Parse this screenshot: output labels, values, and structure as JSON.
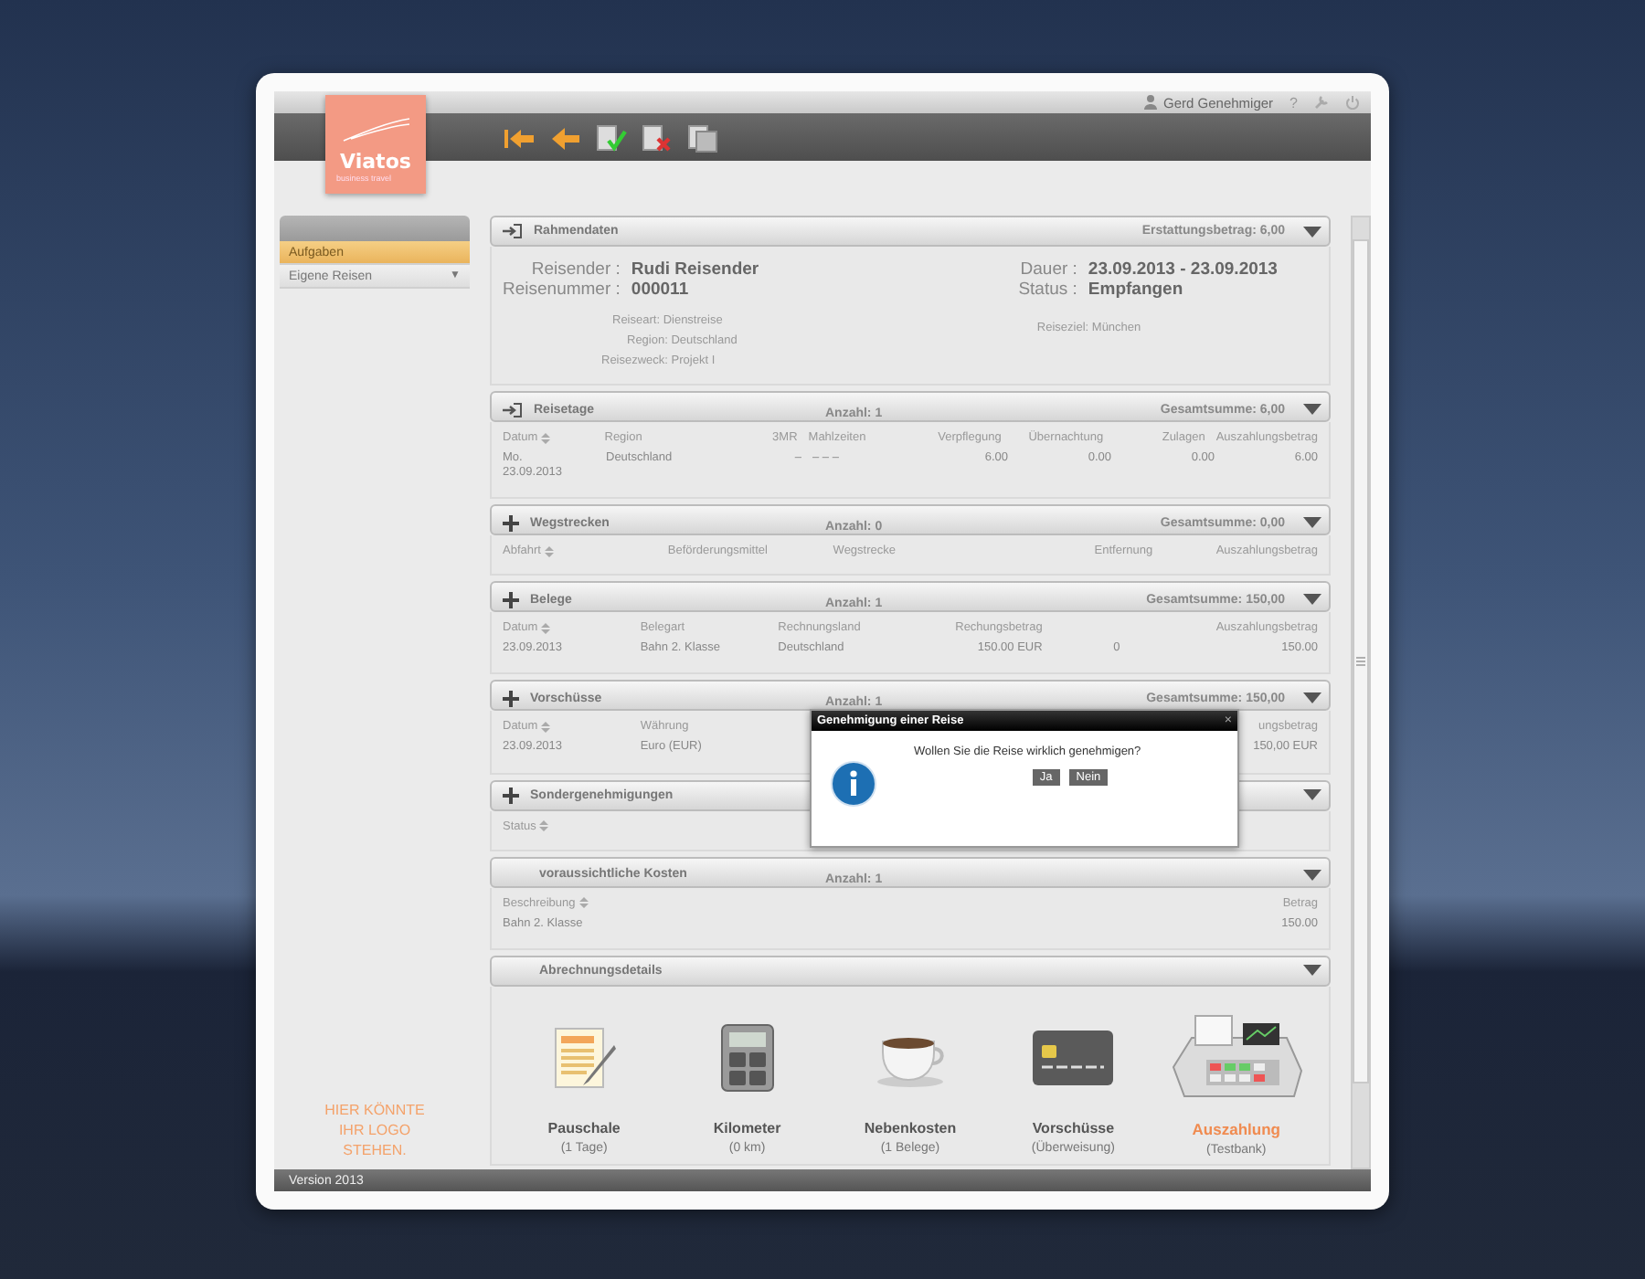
{
  "user": {
    "name": "Gerd Genehmiger",
    "help": "?"
  },
  "logo": {
    "name": "Viatos",
    "tagline": "business travel"
  },
  "sidebar": {
    "items": [
      {
        "label": "Aufgaben",
        "selected": true
      },
      {
        "label": "Eigene Reisen",
        "selected": false,
        "caret": "▼"
      }
    ]
  },
  "ad_lines": [
    "HIER KÖNNTE",
    "IHR LOGO",
    "STEHEN."
  ],
  "sections": [
    {
      "kind": "summary",
      "title": "Rahmendaten",
      "total": "Erstattungsbetrag: 6,00",
      "main_left": [
        {
          "label": "Reisender :",
          "value": "Rudi Reisender"
        },
        {
          "label": "Reisenummer :",
          "value": "000011"
        }
      ],
      "main_right": [
        {
          "label": "Dauer :",
          "value": "23.09.2013 - 23.09.2013"
        },
        {
          "label": "Status :",
          "value": "Empfangen"
        }
      ],
      "minor_left": [
        "Reiseart: Dienstreise",
        "Region: Deutschland",
        "Reisezweck: Projekt I"
      ],
      "minor_right": [
        "Reiseziel: München"
      ]
    },
    {
      "kind": "table",
      "title": "Reisetage",
      "count": "Anzahl: 1",
      "total": "Gesamtsumme: 6,00",
      "columns": [
        {
          "label": "Datum",
          "sortable": true
        },
        {
          "label": "Region",
          "sortable": false
        },
        {
          "label": "3MR",
          "sortable": false
        },
        {
          "label": "Mahlzeiten",
          "sortable": false
        },
        {
          "label": "Verpflegung",
          "sortable": false
        },
        {
          "label": "Übernachtung",
          "sortable": false
        },
        {
          "label": "Zulagen",
          "sortable": false
        },
        {
          "label": "Auszahlungsbetrag",
          "sortable": false
        }
      ],
      "rows": [
        [
          "Mo. 23.09.2013",
          "Deutschland",
          "–",
          "– – –",
          "6.00",
          "0.00",
          "0.00",
          "6.00"
        ]
      ]
    },
    {
      "kind": "table",
      "title": "Wegstrecken",
      "count": "Anzahl: 0",
      "total": "Gesamtsumme: 0,00",
      "columns": [
        {
          "label": "Abfahrt",
          "sortable": true
        },
        {
          "label": "Beförderungsmittel",
          "sortable": false
        },
        {
          "label": "Wegstrecke",
          "sortable": false
        },
        {
          "label": "Entfernung",
          "sortable": false
        },
        {
          "label": "Auszahlungsbetrag",
          "sortable": false
        }
      ]
    },
    {
      "kind": "table",
      "title": "Belege",
      "count": "Anzahl: 1",
      "total": "Gesamtsumme: 150,00",
      "columns": [
        {
          "label": "Datum",
          "sortable": true
        },
        {
          "label": "Belegart",
          "sortable": false
        },
        {
          "label": "Rechnungsland",
          "sortable": false
        },
        {
          "label": "Rechungsbetrag",
          "sortable": false
        },
        {},
        {
          "label": "Auszahlungsbetrag",
          "sortable": false
        }
      ],
      "rows": [
        [
          "23.09.2013",
          "Bahn 2. Klasse",
          "Deutschland",
          "150.00 EUR",
          "0",
          "150.00"
        ]
      ]
    },
    {
      "kind": "table",
      "title": "Vorschüsse",
      "count": "Anzahl: 1",
      "total": "Gesamtsumme: 150,00",
      "columns": [
        {
          "label": "Datum",
          "sortable": true
        },
        {
          "label": "Währung",
          "sortable": false
        },
        {},
        {},
        {},
        {
          "label": "ungsbetrag",
          "sortable": false
        }
      ],
      "rows": [
        [
          "23.09.2013",
          "Euro (EUR)",
          null,
          null,
          null,
          "150,00 EUR"
        ]
      ]
    },
    {
      "kind": "table",
      "title": "Sondergenehmigungen",
      "columns": [
        {
          "label": "Status",
          "sortable": true
        }
      ]
    },
    {
      "kind": "table",
      "title": "voraussichtliche Kosten",
      "count": "Anzahl: 1",
      "columns": [
        {
          "label": "Beschreibung",
          "sortable": true
        },
        {
          "label": "Betrag",
          "sortable": false
        }
      ],
      "rows": [
        [
          "Bahn 2. Klasse",
          "150.00"
        ]
      ]
    },
    {
      "kind": "details",
      "title": "Abrechnungsdetails",
      "items": [
        {
          "label": "Pauschale",
          "sub": "(1 Tage)",
          "highlight": false
        },
        {
          "label": "Kilometer",
          "sub": "(0 km)",
          "highlight": false
        },
        {
          "label": "Nebenkosten",
          "sub": "(1 Belege)",
          "highlight": false
        },
        {
          "label": "Vorschüsse",
          "sub": "(Überweisung)",
          "highlight": false
        },
        {
          "label": "Auszahlung",
          "sub": "(Testbank)",
          "highlight": true
        }
      ]
    }
  ],
  "dialog": {
    "title": "Genehmigung einer Reise",
    "close": "×",
    "message": "Wollen Sie die Reise wirklich genehmigen?",
    "buttons": [
      "Ja",
      "Nein"
    ]
  },
  "footer": "Version 2013"
}
